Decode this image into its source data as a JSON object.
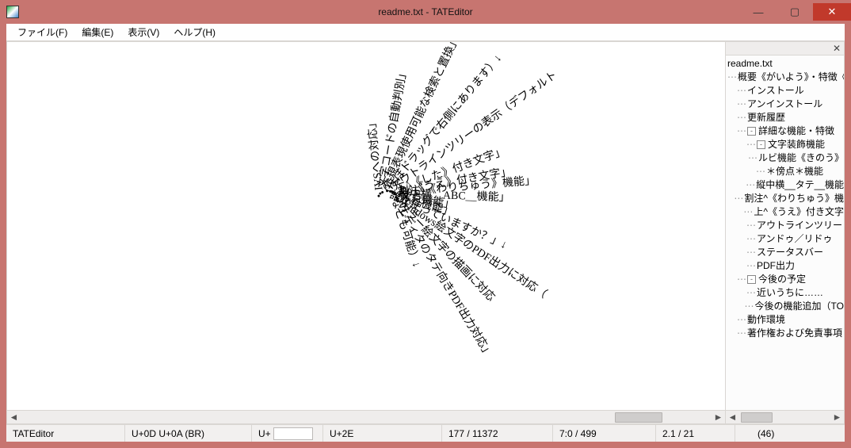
{
  "window": {
    "title": "readme.txt - TATEditor"
  },
  "menubar": {
    "items": [
      "ファイル(F)",
      "編集(E)",
      "表示(V)",
      "ヘルプ(H)"
    ]
  },
  "editor": {
    "rays": [
      {
        "text": "・IVSへの対応」",
        "angle": 186
      },
      {
        "text": "・文字コードの自動判別」",
        "angle": 170
      },
      {
        "text": "・正規表現使用可能な検索と置換」",
        "angle": 155
      },
      {
        "text": "（ほぼドラッグで右側にあります）↓",
        "angle": 140
      },
      {
        "text": "・アウトラインツリーの表示（デフォルト",
        "angle": 125
      },
      {
        "text": "・下^《した》付き文字」",
        "angle": 110
      },
      {
        "text": "・上^《うえ》付き文字」",
        "angle": 100
      },
      {
        "text": "・割注^《わりちゅう》機能」",
        "angle": 95
      },
      {
        "text": "・縦中横__ABC__機能」",
        "angle": 88
      },
      {
        "text": "・傍点機能」",
        "angle": 80
      },
      {
        "text": "・ルビ機能」",
        "angle": 73
      },
      {
        "text": "誰か使っていますか？」↓",
        "angle": 66
      },
      {
        "text": "・Windows絵文字のPDF出力に対応（",
        "angle": 57
      },
      {
        "text": "・カラー絵文字の描画に対応",
        "angle": 44
      },
      {
        "text": "・エディタのタテ向きPDF出力対応」",
        "angle": 31
      },
      {
        "text": "なども可能）↓",
        "angle": 18
      }
    ]
  },
  "tree": {
    "items": [
      {
        "depth": 0,
        "twist": "",
        "label": "readme.txt"
      },
      {
        "depth": 1,
        "twist": "",
        "label": "概要《がいよう》・特徴《とく"
      },
      {
        "depth": 1,
        "twist": "",
        "label": "インストール"
      },
      {
        "depth": 1,
        "twist": "",
        "label": "アンインストール"
      },
      {
        "depth": 1,
        "twist": "",
        "label": "更新履歴"
      },
      {
        "depth": 1,
        "twist": "-",
        "label": "詳細な機能・特徴"
      },
      {
        "depth": 2,
        "twist": "-",
        "label": "文字装飾機能"
      },
      {
        "depth": 3,
        "twist": "",
        "label": "ルビ機能《きのう》"
      },
      {
        "depth": 3,
        "twist": "",
        "label": "＊傍点＊機能"
      },
      {
        "depth": 3,
        "twist": "",
        "label": "縦中横__タテ__機能"
      },
      {
        "depth": 3,
        "twist": "",
        "label": "割注^《わりちゅう》機"
      },
      {
        "depth": 3,
        "twist": "",
        "label": "上^《うえ》付き文字"
      },
      {
        "depth": 2,
        "twist": "",
        "label": "アウトラインツリー"
      },
      {
        "depth": 2,
        "twist": "",
        "label": "アンドゥ／リドゥ"
      },
      {
        "depth": 2,
        "twist": "",
        "label": "ステータスバー"
      },
      {
        "depth": 2,
        "twist": "",
        "label": "PDF出力"
      },
      {
        "depth": 1,
        "twist": "-",
        "label": "今後の予定"
      },
      {
        "depth": 2,
        "twist": "",
        "label": "近いうちに……"
      },
      {
        "depth": 2,
        "twist": "",
        "label": "今後の機能追加（TO"
      },
      {
        "depth": 1,
        "twist": "",
        "label": "動作環境"
      },
      {
        "depth": 1,
        "twist": "",
        "label": "著作権および免責事項"
      }
    ]
  },
  "statusbar": {
    "app": "TATEditor",
    "code1": "U+0D U+0A (BR)",
    "code_prefix": "U+",
    "code2": "U+2E",
    "pos": "177 / 11372",
    "line": "7:0 / 499",
    "scale": "2.1 / 21",
    "right": "(46)"
  },
  "icons": {
    "min": "—",
    "max": "▢",
    "close": "✕",
    "left": "◄",
    "right": "►",
    "x": "✕"
  }
}
